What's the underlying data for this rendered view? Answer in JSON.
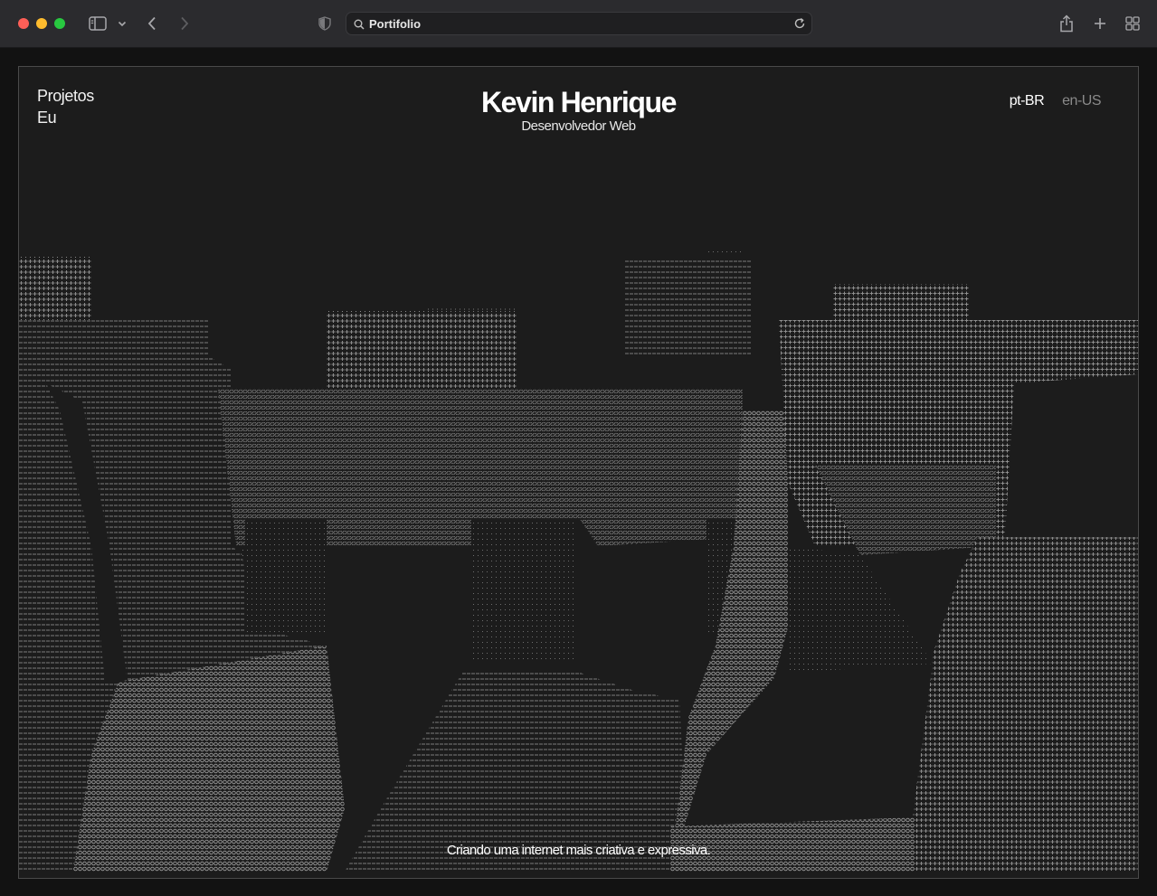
{
  "browser": {
    "address_text": "Portifolio",
    "icons": [
      "sidebar-icon",
      "chevron-down-icon",
      "back-icon",
      "forward-icon",
      "shield-icon",
      "search-icon",
      "reload-icon",
      "share-icon",
      "plus-icon",
      "tabs-grid-icon"
    ]
  },
  "site": {
    "nav": {
      "projects": "Projetos",
      "about": "Eu"
    },
    "brand": {
      "name": "Kevin Henrique",
      "role": "Desenvolvedor Web"
    },
    "languages": {
      "active": "pt-BR",
      "inactive": "en-US"
    },
    "tagline": "Criando uma internet mais criativa e expressiva."
  },
  "colors": {
    "page_bg": "#1c1c1c",
    "ascii_light": "#8e8e8e",
    "ascii_dark": "#555555"
  }
}
